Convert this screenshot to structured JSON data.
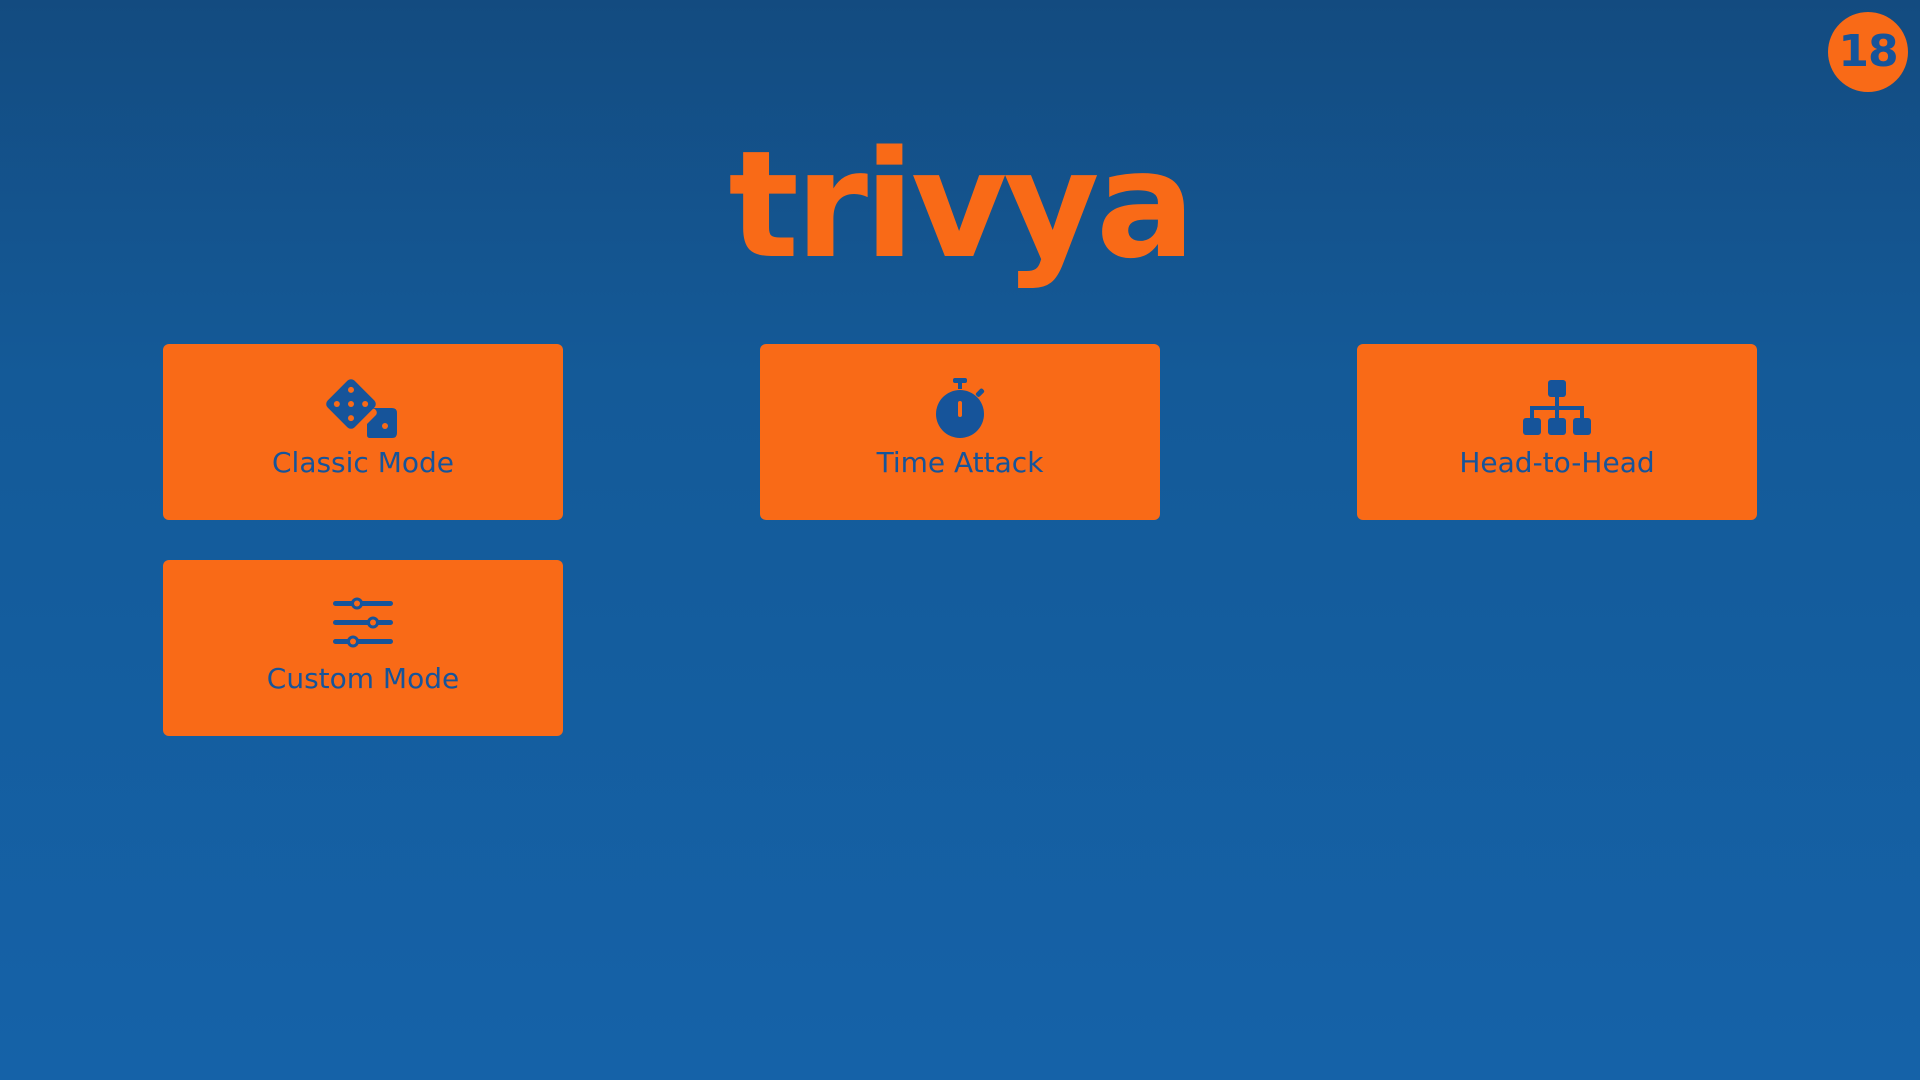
{
  "badge": {
    "value": "18"
  },
  "logo": {
    "text": "trivya"
  },
  "modes": [
    {
      "id": "classic",
      "label": "Classic Mode",
      "icon": "dice-icon"
    },
    {
      "id": "time",
      "label": "Time Attack",
      "icon": "stopwatch-icon"
    },
    {
      "id": "h2h",
      "label": "Head-to-Head",
      "icon": "sitemap-icon"
    },
    {
      "id": "custom",
      "label": "Custom Mode",
      "icon": "sliders-icon"
    }
  ],
  "colors": {
    "accent": "#f96a17",
    "background_top": "#134b80",
    "background_bottom": "#1562a8",
    "text_on_accent": "#16549a"
  }
}
